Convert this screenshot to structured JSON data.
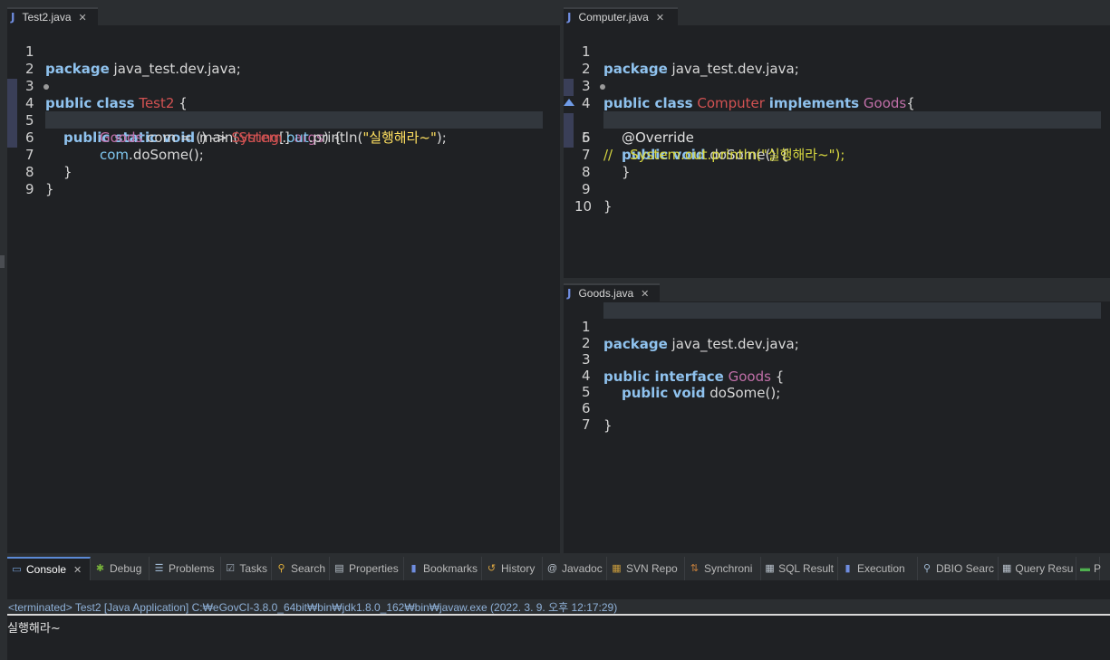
{
  "editors": {
    "test2": {
      "tab_label": "Test2.java",
      "lines": {
        "n1": "1",
        "n2": "2",
        "n3": "3",
        "n4": "4",
        "n5": "5",
        "n6": "6",
        "n7": "7",
        "n8": "8",
        "n9": "9"
      },
      "code": {
        "l1_kw": "package",
        "l1_rest": " java_test.dev.java;",
        "l3_kw": "public class",
        "l3_cls": "Test2",
        "l3_rest": " {",
        "l4_kw": "public static void",
        "l4_m": " main(",
        "l4_ty": "String",
        "l4_b": "[] ",
        "l4_arg": "args",
        "l4_rest": ") {",
        "l5_ty": "Goods",
        "l5_a": " com = () -> ",
        "l5_sys": "System",
        "l5_dot": ".",
        "l5_out": "out",
        "l5_p": ".println(",
        "l5_str": "\"실행해라~\"",
        "l5_end": ");",
        "l6_fld": "com",
        "l6_rest": ".doSome();",
        "l7": "}",
        "l8": "}"
      }
    },
    "computer": {
      "tab_label": "Computer.java",
      "lines": {
        "n1": "1",
        "n2": "2",
        "n3": "3",
        "n4": "4",
        "n5": "5",
        "n6": "6",
        "n7": "7",
        "n8": "8",
        "n9": "9",
        "n10": "10"
      },
      "code": {
        "l1_kw": "package",
        "l1_rest": " java_test.dev.java;",
        "l3_kw": "public class",
        "l3_cls": "Computer",
        "l3_kw2": "implements",
        "l3_ty": "Goods",
        "l3_rest": "{",
        "l4": "@Override",
        "l5_kw": "public void",
        "l5_rest": " doSome() {",
        "l6_cmt": "//    System.out.println(\"실행해라~\");",
        "l7": "}",
        "l9": "}"
      }
    },
    "goods": {
      "tab_label": "Goods.java",
      "lines": {
        "n1": "1",
        "n2": "2",
        "n3": "3",
        "n4": "4",
        "n5": "5",
        "n6": "6",
        "n7": "7"
      },
      "code": {
        "l1_kw": "package",
        "l1_rest": " java_test.dev.java;",
        "l3_kw": "public interface",
        "l3_ty": "Goods",
        "l3_rest": " {",
        "l4_kw": "public void",
        "l4_rest": " doSome();",
        "l6": "}"
      }
    }
  },
  "console": {
    "tabs": [
      {
        "label": "Console",
        "icon": "monitor-icon"
      },
      {
        "label": "Debug",
        "icon": "bug-icon"
      },
      {
        "label": "Problems",
        "icon": "problems-icon"
      },
      {
        "label": "Tasks",
        "icon": "tasks-icon"
      },
      {
        "label": "Search",
        "icon": "search-icon"
      },
      {
        "label": "Properties",
        "icon": "properties-icon"
      },
      {
        "label": "Bookmarks",
        "icon": "bookmark-icon"
      },
      {
        "label": "History",
        "icon": "history-icon"
      },
      {
        "label": "Javadoc",
        "icon": "at-icon"
      },
      {
        "label": "SVN Repo",
        "icon": "svn-icon"
      },
      {
        "label": "Synchroni",
        "icon": "sync-icon"
      },
      {
        "label": "SQL Result",
        "icon": "table-icon"
      },
      {
        "label": "Execution",
        "icon": "execution-icon"
      },
      {
        "label": "DBIO Searc",
        "icon": "dbio-icon"
      },
      {
        "label": "Query Resu",
        "icon": "grid-icon"
      },
      {
        "label": "P",
        "icon": "panel-icon"
      }
    ],
    "status": "<terminated> Test2 [Java Application] C:₩eGovCI-3.8.0_64bit₩bin₩jdk1.8.0_162₩bin₩javaw.exe (2022. 3. 9. 오후 12:17:29)",
    "output": "실행해라~"
  },
  "colors": {
    "background": "#1f2124",
    "keyword": "#8fc2ee",
    "class_name": "#d25252",
    "type_name": "#c06fa8",
    "string": "#ffe060",
    "comment": "#d8d840"
  }
}
